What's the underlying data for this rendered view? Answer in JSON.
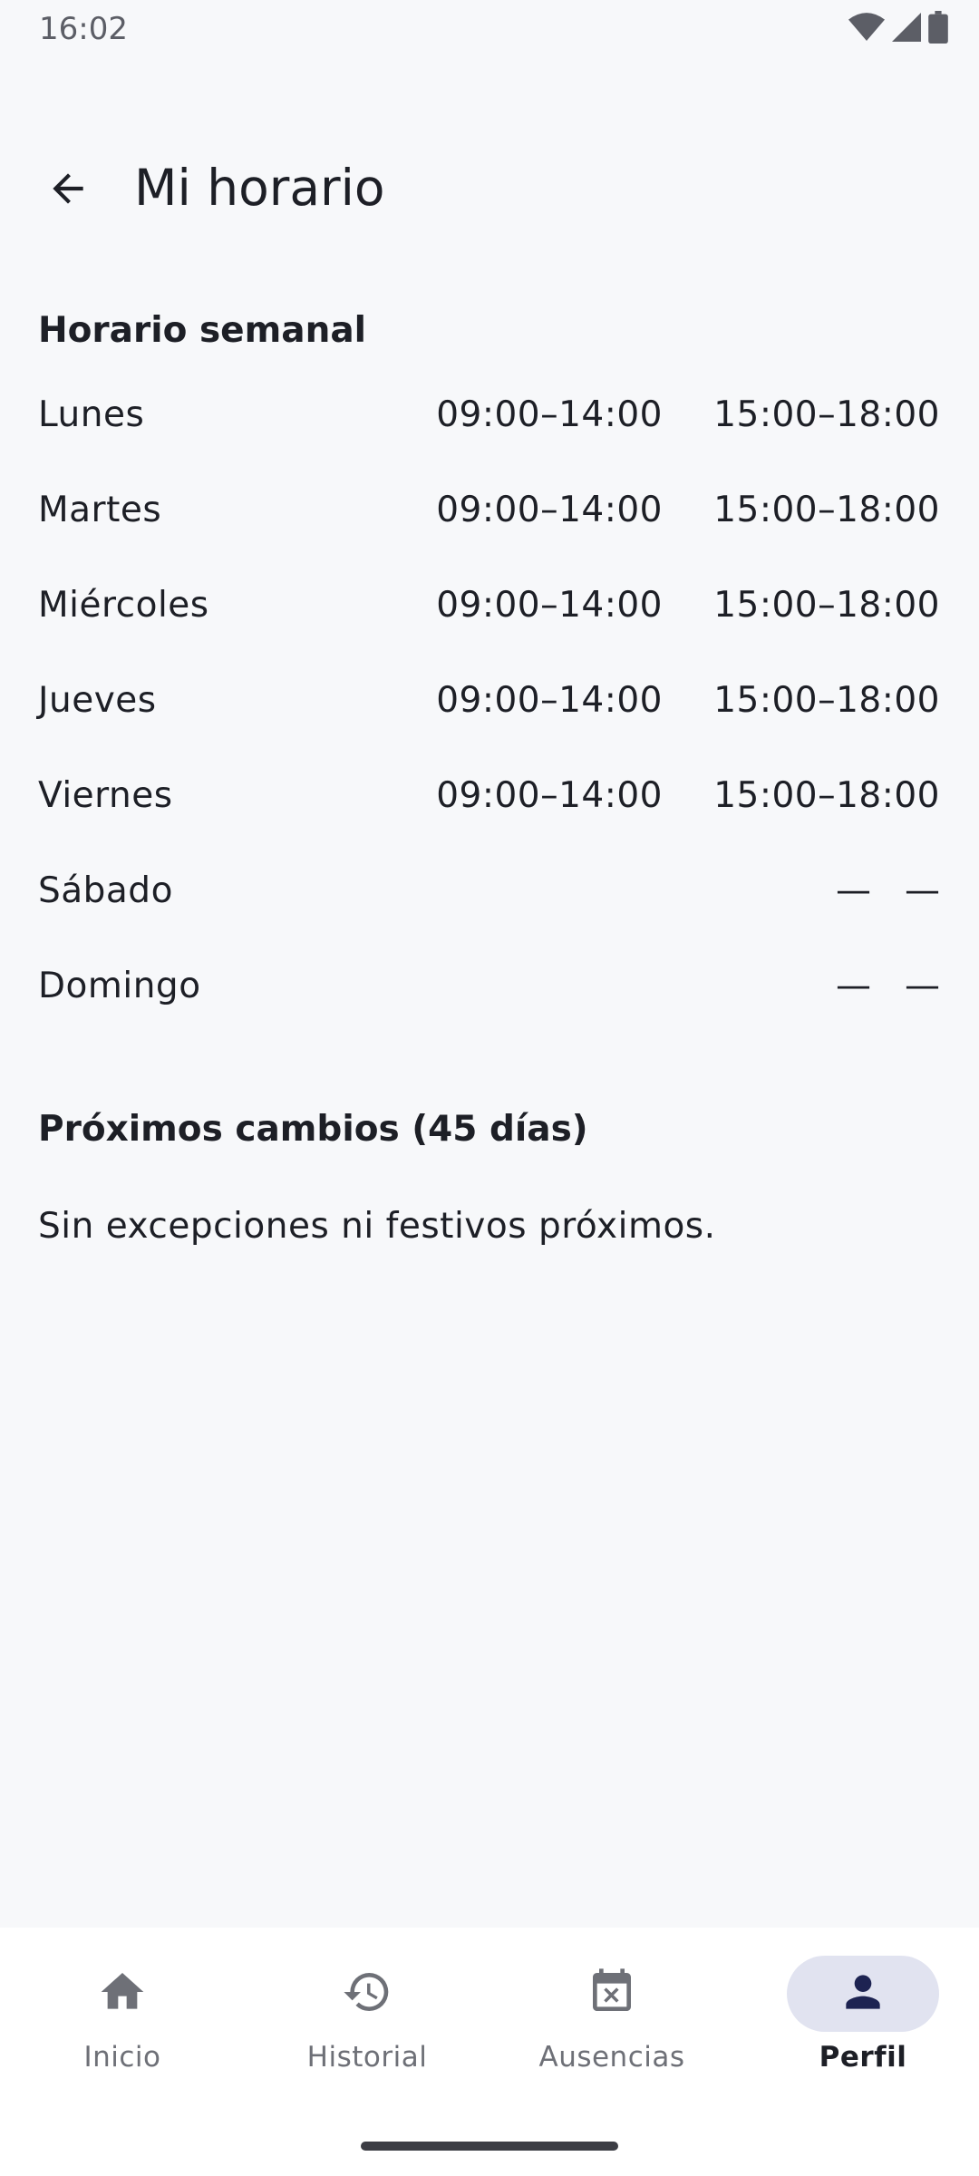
{
  "status_bar": {
    "time": "16:02",
    "icons": [
      "wifi-icon",
      "signal-icon",
      "battery-icon"
    ]
  },
  "app_bar": {
    "back_icon": "arrow-left-icon",
    "title": "Mi horario"
  },
  "weekly": {
    "heading": "Horario semanal",
    "rows": [
      {
        "day": "Lunes",
        "slot1": "09:00–14:00",
        "slot2": "15:00–18:00"
      },
      {
        "day": "Martes",
        "slot1": "09:00–14:00",
        "slot2": "15:00–18:00"
      },
      {
        "day": "Miércoles",
        "slot1": "09:00–14:00",
        "slot2": "15:00–18:00"
      },
      {
        "day": "Jueves",
        "slot1": "09:00–14:00",
        "slot2": "15:00–18:00"
      },
      {
        "day": "Viernes",
        "slot1": "09:00–14:00",
        "slot2": "15:00–18:00"
      },
      {
        "day": "Sábado",
        "slot1": "—",
        "slot2": "—"
      },
      {
        "day": "Domingo",
        "slot1": "—",
        "slot2": "—"
      }
    ]
  },
  "changes": {
    "heading": "Próximos cambios (45 días)",
    "empty_message": "Sin excepciones ni festivos próximos."
  },
  "bottom_nav": {
    "items": [
      {
        "label": "Inicio",
        "icon": "home-icon",
        "active": false
      },
      {
        "label": "Historial",
        "icon": "history-icon",
        "active": false
      },
      {
        "label": "Ausencias",
        "icon": "calendar-cancel-icon",
        "active": false
      },
      {
        "label": "Perfil",
        "icon": "person-icon",
        "active": true
      }
    ]
  },
  "colors": {
    "background": "#f7f8fa",
    "nav_background": "#ffffff",
    "active_pill": "#e1e3f0",
    "active_icon": "#1d2352",
    "inactive": "#6e7077"
  }
}
